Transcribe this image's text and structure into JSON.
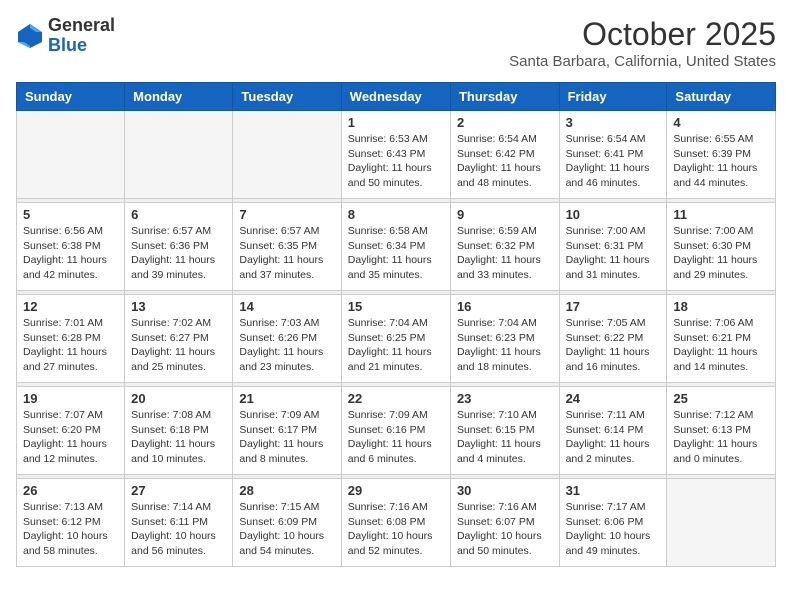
{
  "logo": {
    "general": "General",
    "blue": "Blue"
  },
  "header": {
    "month": "October 2025",
    "location": "Santa Barbara, California, United States"
  },
  "weekdays": [
    "Sunday",
    "Monday",
    "Tuesday",
    "Wednesday",
    "Thursday",
    "Friday",
    "Saturday"
  ],
  "weeks": [
    [
      {
        "day": "",
        "info": ""
      },
      {
        "day": "",
        "info": ""
      },
      {
        "day": "",
        "info": ""
      },
      {
        "day": "1",
        "info": "Sunrise: 6:53 AM\nSunset: 6:43 PM\nDaylight: 11 hours\nand 50 minutes."
      },
      {
        "day": "2",
        "info": "Sunrise: 6:54 AM\nSunset: 6:42 PM\nDaylight: 11 hours\nand 48 minutes."
      },
      {
        "day": "3",
        "info": "Sunrise: 6:54 AM\nSunset: 6:41 PM\nDaylight: 11 hours\nand 46 minutes."
      },
      {
        "day": "4",
        "info": "Sunrise: 6:55 AM\nSunset: 6:39 PM\nDaylight: 11 hours\nand 44 minutes."
      }
    ],
    [
      {
        "day": "5",
        "info": "Sunrise: 6:56 AM\nSunset: 6:38 PM\nDaylight: 11 hours\nand 42 minutes."
      },
      {
        "day": "6",
        "info": "Sunrise: 6:57 AM\nSunset: 6:36 PM\nDaylight: 11 hours\nand 39 minutes."
      },
      {
        "day": "7",
        "info": "Sunrise: 6:57 AM\nSunset: 6:35 PM\nDaylight: 11 hours\nand 37 minutes."
      },
      {
        "day": "8",
        "info": "Sunrise: 6:58 AM\nSunset: 6:34 PM\nDaylight: 11 hours\nand 35 minutes."
      },
      {
        "day": "9",
        "info": "Sunrise: 6:59 AM\nSunset: 6:32 PM\nDaylight: 11 hours\nand 33 minutes."
      },
      {
        "day": "10",
        "info": "Sunrise: 7:00 AM\nSunset: 6:31 PM\nDaylight: 11 hours\nand 31 minutes."
      },
      {
        "day": "11",
        "info": "Sunrise: 7:00 AM\nSunset: 6:30 PM\nDaylight: 11 hours\nand 29 minutes."
      }
    ],
    [
      {
        "day": "12",
        "info": "Sunrise: 7:01 AM\nSunset: 6:28 PM\nDaylight: 11 hours\nand 27 minutes."
      },
      {
        "day": "13",
        "info": "Sunrise: 7:02 AM\nSunset: 6:27 PM\nDaylight: 11 hours\nand 25 minutes."
      },
      {
        "day": "14",
        "info": "Sunrise: 7:03 AM\nSunset: 6:26 PM\nDaylight: 11 hours\nand 23 minutes."
      },
      {
        "day": "15",
        "info": "Sunrise: 7:04 AM\nSunset: 6:25 PM\nDaylight: 11 hours\nand 21 minutes."
      },
      {
        "day": "16",
        "info": "Sunrise: 7:04 AM\nSunset: 6:23 PM\nDaylight: 11 hours\nand 18 minutes."
      },
      {
        "day": "17",
        "info": "Sunrise: 7:05 AM\nSunset: 6:22 PM\nDaylight: 11 hours\nand 16 minutes."
      },
      {
        "day": "18",
        "info": "Sunrise: 7:06 AM\nSunset: 6:21 PM\nDaylight: 11 hours\nand 14 minutes."
      }
    ],
    [
      {
        "day": "19",
        "info": "Sunrise: 7:07 AM\nSunset: 6:20 PM\nDaylight: 11 hours\nand 12 minutes."
      },
      {
        "day": "20",
        "info": "Sunrise: 7:08 AM\nSunset: 6:18 PM\nDaylight: 11 hours\nand 10 minutes."
      },
      {
        "day": "21",
        "info": "Sunrise: 7:09 AM\nSunset: 6:17 PM\nDaylight: 11 hours\nand 8 minutes."
      },
      {
        "day": "22",
        "info": "Sunrise: 7:09 AM\nSunset: 6:16 PM\nDaylight: 11 hours\nand 6 minutes."
      },
      {
        "day": "23",
        "info": "Sunrise: 7:10 AM\nSunset: 6:15 PM\nDaylight: 11 hours\nand 4 minutes."
      },
      {
        "day": "24",
        "info": "Sunrise: 7:11 AM\nSunset: 6:14 PM\nDaylight: 11 hours\nand 2 minutes."
      },
      {
        "day": "25",
        "info": "Sunrise: 7:12 AM\nSunset: 6:13 PM\nDaylight: 11 hours\nand 0 minutes."
      }
    ],
    [
      {
        "day": "26",
        "info": "Sunrise: 7:13 AM\nSunset: 6:12 PM\nDaylight: 10 hours\nand 58 minutes."
      },
      {
        "day": "27",
        "info": "Sunrise: 7:14 AM\nSunset: 6:11 PM\nDaylight: 10 hours\nand 56 minutes."
      },
      {
        "day": "28",
        "info": "Sunrise: 7:15 AM\nSunset: 6:09 PM\nDaylight: 10 hours\nand 54 minutes."
      },
      {
        "day": "29",
        "info": "Sunrise: 7:16 AM\nSunset: 6:08 PM\nDaylight: 10 hours\nand 52 minutes."
      },
      {
        "day": "30",
        "info": "Sunrise: 7:16 AM\nSunset: 6:07 PM\nDaylight: 10 hours\nand 50 minutes."
      },
      {
        "day": "31",
        "info": "Sunrise: 7:17 AM\nSunset: 6:06 PM\nDaylight: 10 hours\nand 49 minutes."
      },
      {
        "day": "",
        "info": ""
      }
    ]
  ]
}
